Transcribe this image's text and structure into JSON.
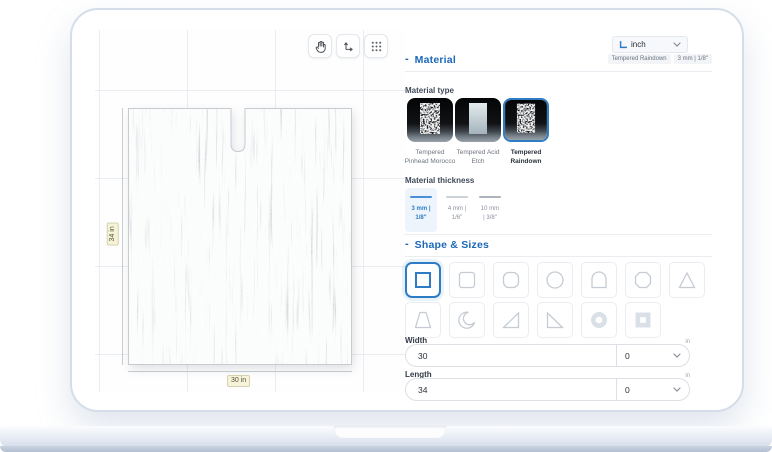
{
  "device": {
    "kind": "laptop-mockup"
  },
  "toolbar": {
    "icons": [
      "pan-hand-icon",
      "orthogonal-arrows-icon",
      "grid-dots-icon"
    ]
  },
  "unit_select": {
    "icon": "ruler-icon",
    "value": "inch"
  },
  "canvas": {
    "vertical_dim_label": "34 in",
    "horizontal_dim_label": "30 in"
  },
  "material": {
    "collapse_glyph": "-",
    "title": "Material",
    "selected_type_badge": "Tempered Raindown",
    "selected_thickness_badge": "3 mm | 1/8\"",
    "type_label": "Material type",
    "types": [
      {
        "name": "Tempered Pinhead Morocco",
        "selected": false
      },
      {
        "name": "Tempered Acid Etch",
        "selected": false
      },
      {
        "name": "Tempered Raindown",
        "selected": true
      }
    ],
    "thickness_label": "Material thickness",
    "thicknesses": [
      {
        "line1": "3 mm |",
        "line2": "1/8\"",
        "selected": true
      },
      {
        "line1": "4 mm |",
        "line2": "1/6\"",
        "selected": false
      },
      {
        "line1": "10 mm",
        "line2": "| 3/8\"",
        "selected": false
      }
    ]
  },
  "shape_section": {
    "collapse_glyph": "-",
    "title": "Shape & Sizes",
    "options": [
      "square",
      "rounded-square",
      "round-corner-square",
      "circle",
      "arch",
      "octagon",
      "triangle",
      "trapezoid",
      "crescent",
      "right-triangle-right",
      "right-triangle-left",
      "ring",
      "frame-square"
    ],
    "selected": "square"
  },
  "dimensions": {
    "width": {
      "label": "Width",
      "unit": "in",
      "value": "30",
      "fraction": "0"
    },
    "length": {
      "label": "Length",
      "unit": "in",
      "value": "34",
      "fraction": "0"
    }
  }
}
